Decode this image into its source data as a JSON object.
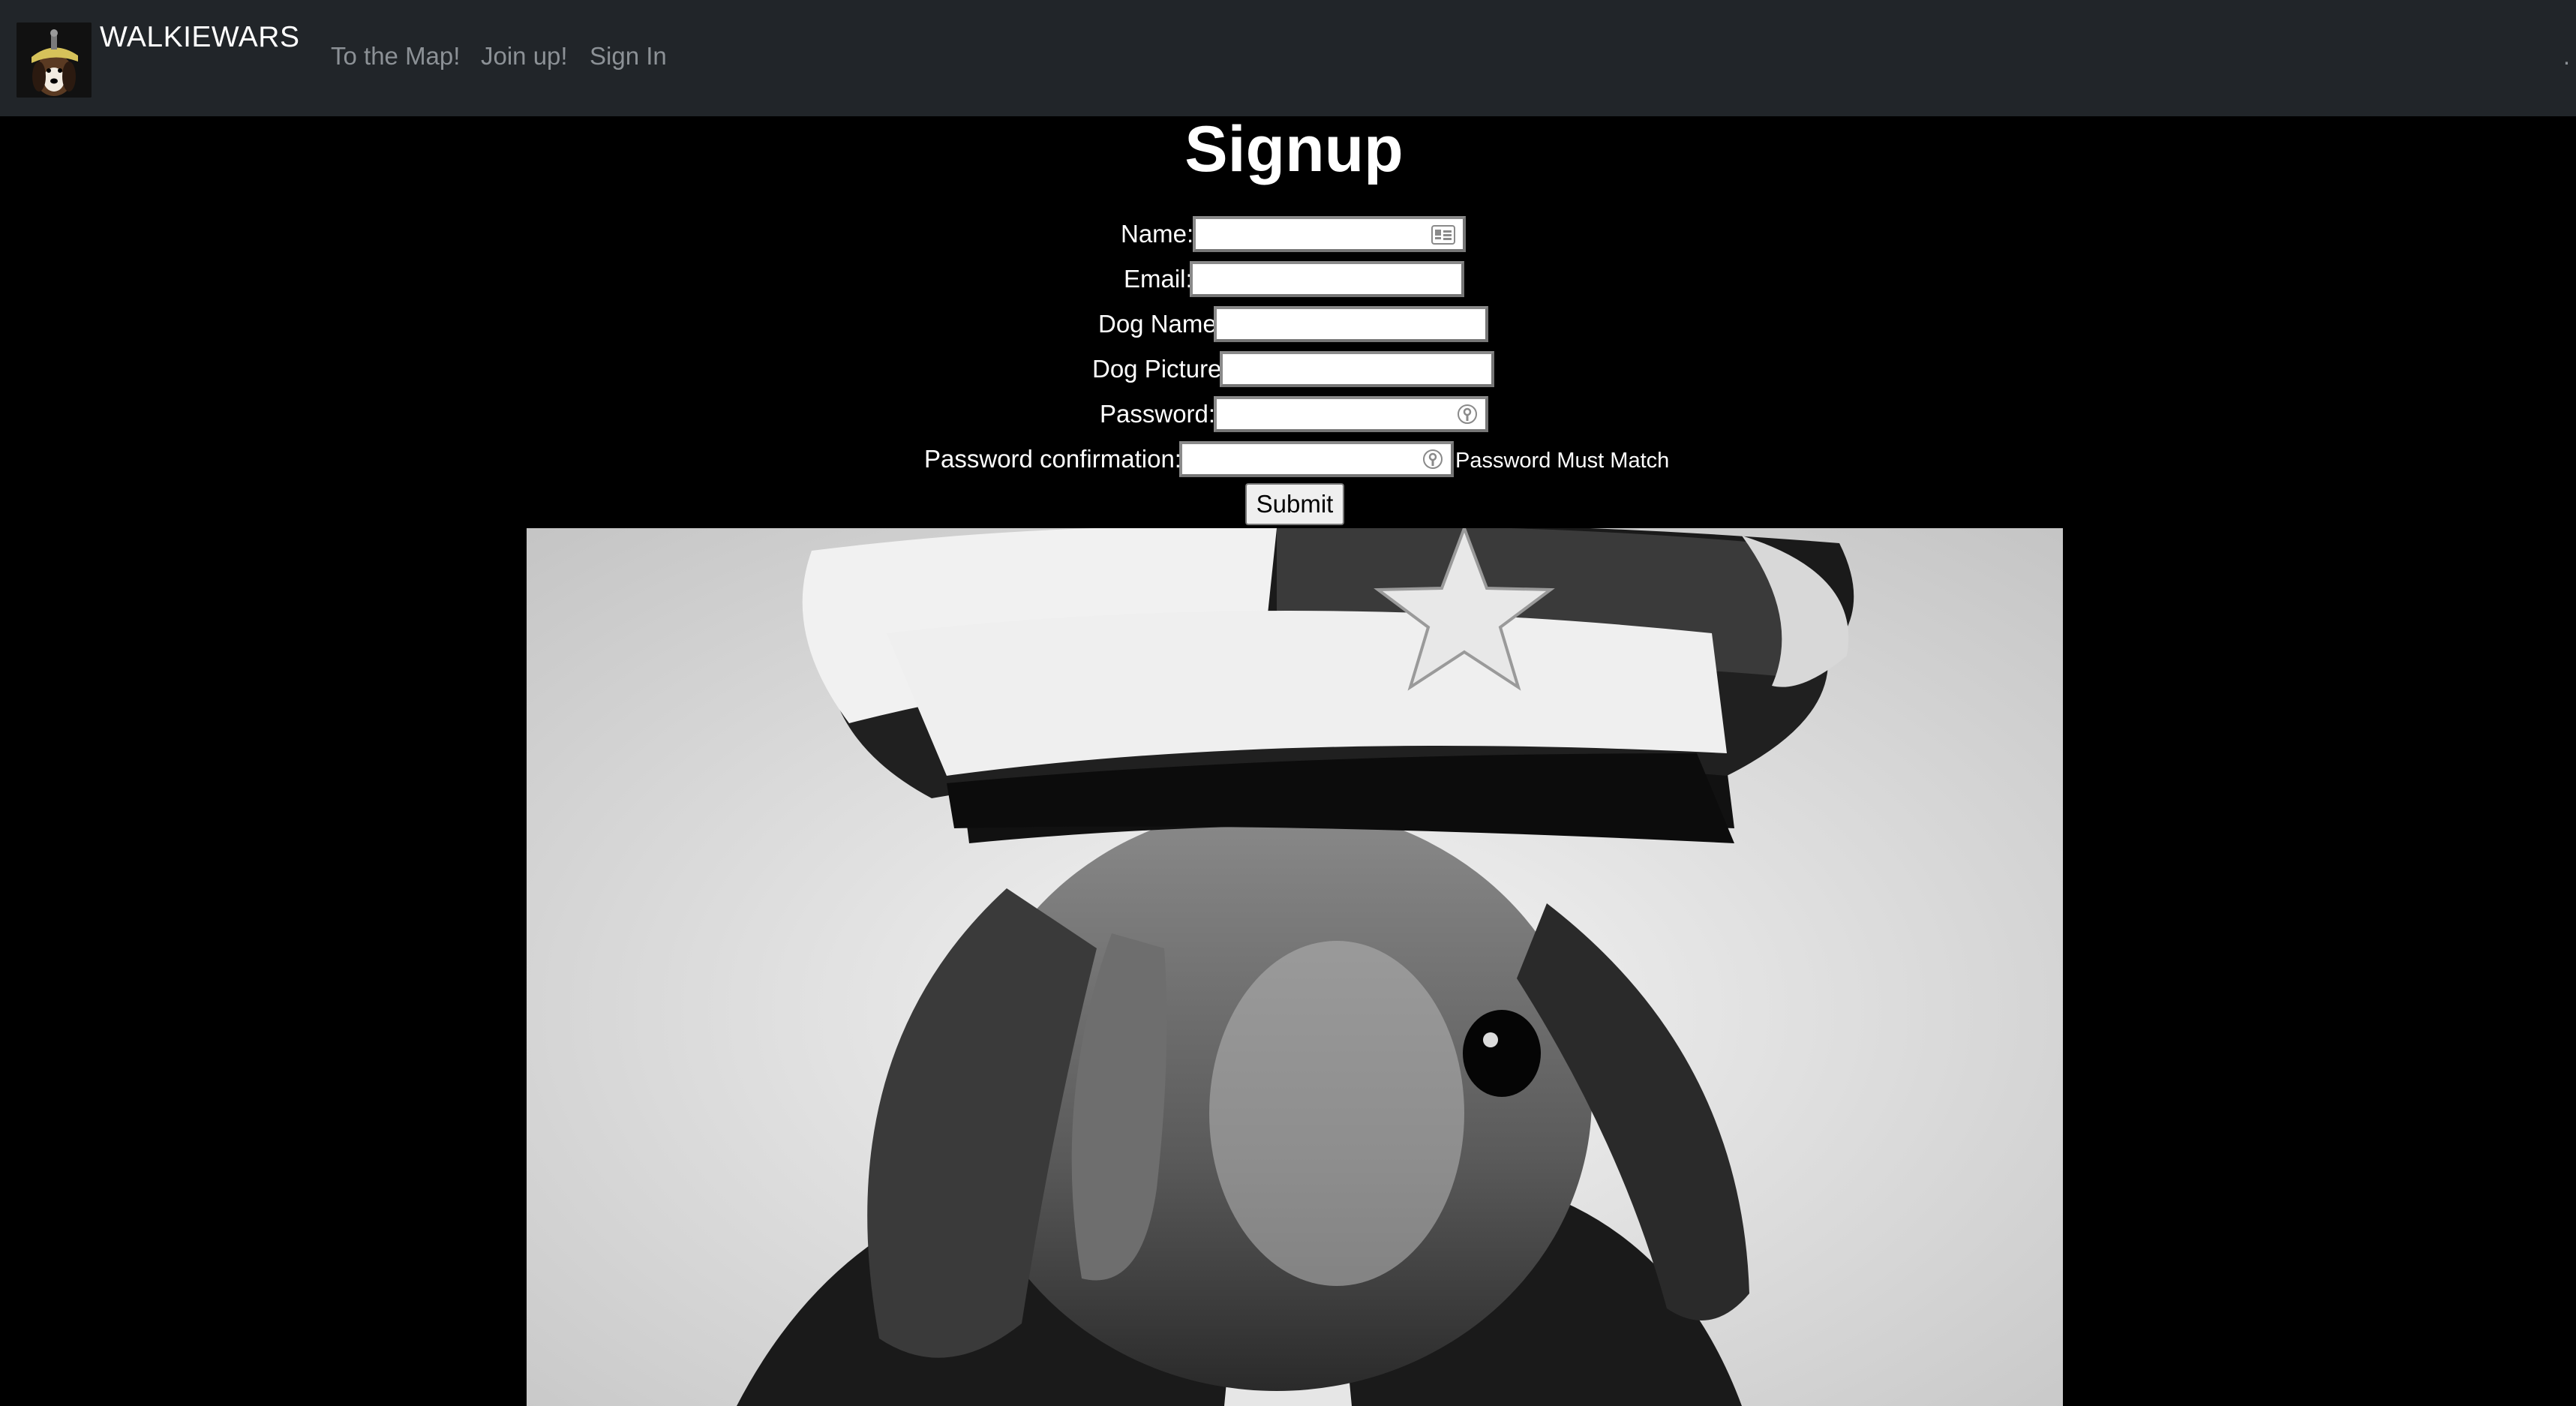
{
  "navbar": {
    "brand": "WALKIEWARS",
    "links": [
      "To the Map!",
      "Join up!",
      "Sign In"
    ],
    "right_text": "."
  },
  "form": {
    "title": "Signup",
    "fields": {
      "name": {
        "label": "Name:",
        "value": ""
      },
      "email": {
        "label": "Email:",
        "value": ""
      },
      "dog_name": {
        "label": "Dog Name",
        "value": ""
      },
      "dog_picture": {
        "label": "Dog Picture",
        "value": ""
      },
      "password": {
        "label": "Password:",
        "value": ""
      },
      "password_confirmation": {
        "label": "Password confirmation:",
        "value": ""
      }
    },
    "password_hint": "Password Must Match",
    "submit_label": "Submit"
  },
  "icons": {
    "name_field": "contact-card-icon",
    "password_field": "key-icon",
    "password_confirmation_field": "key-icon"
  },
  "colors": {
    "navbar_bg": "#212529",
    "page_bg": "#000000",
    "nav_link": "#8c9196"
  }
}
